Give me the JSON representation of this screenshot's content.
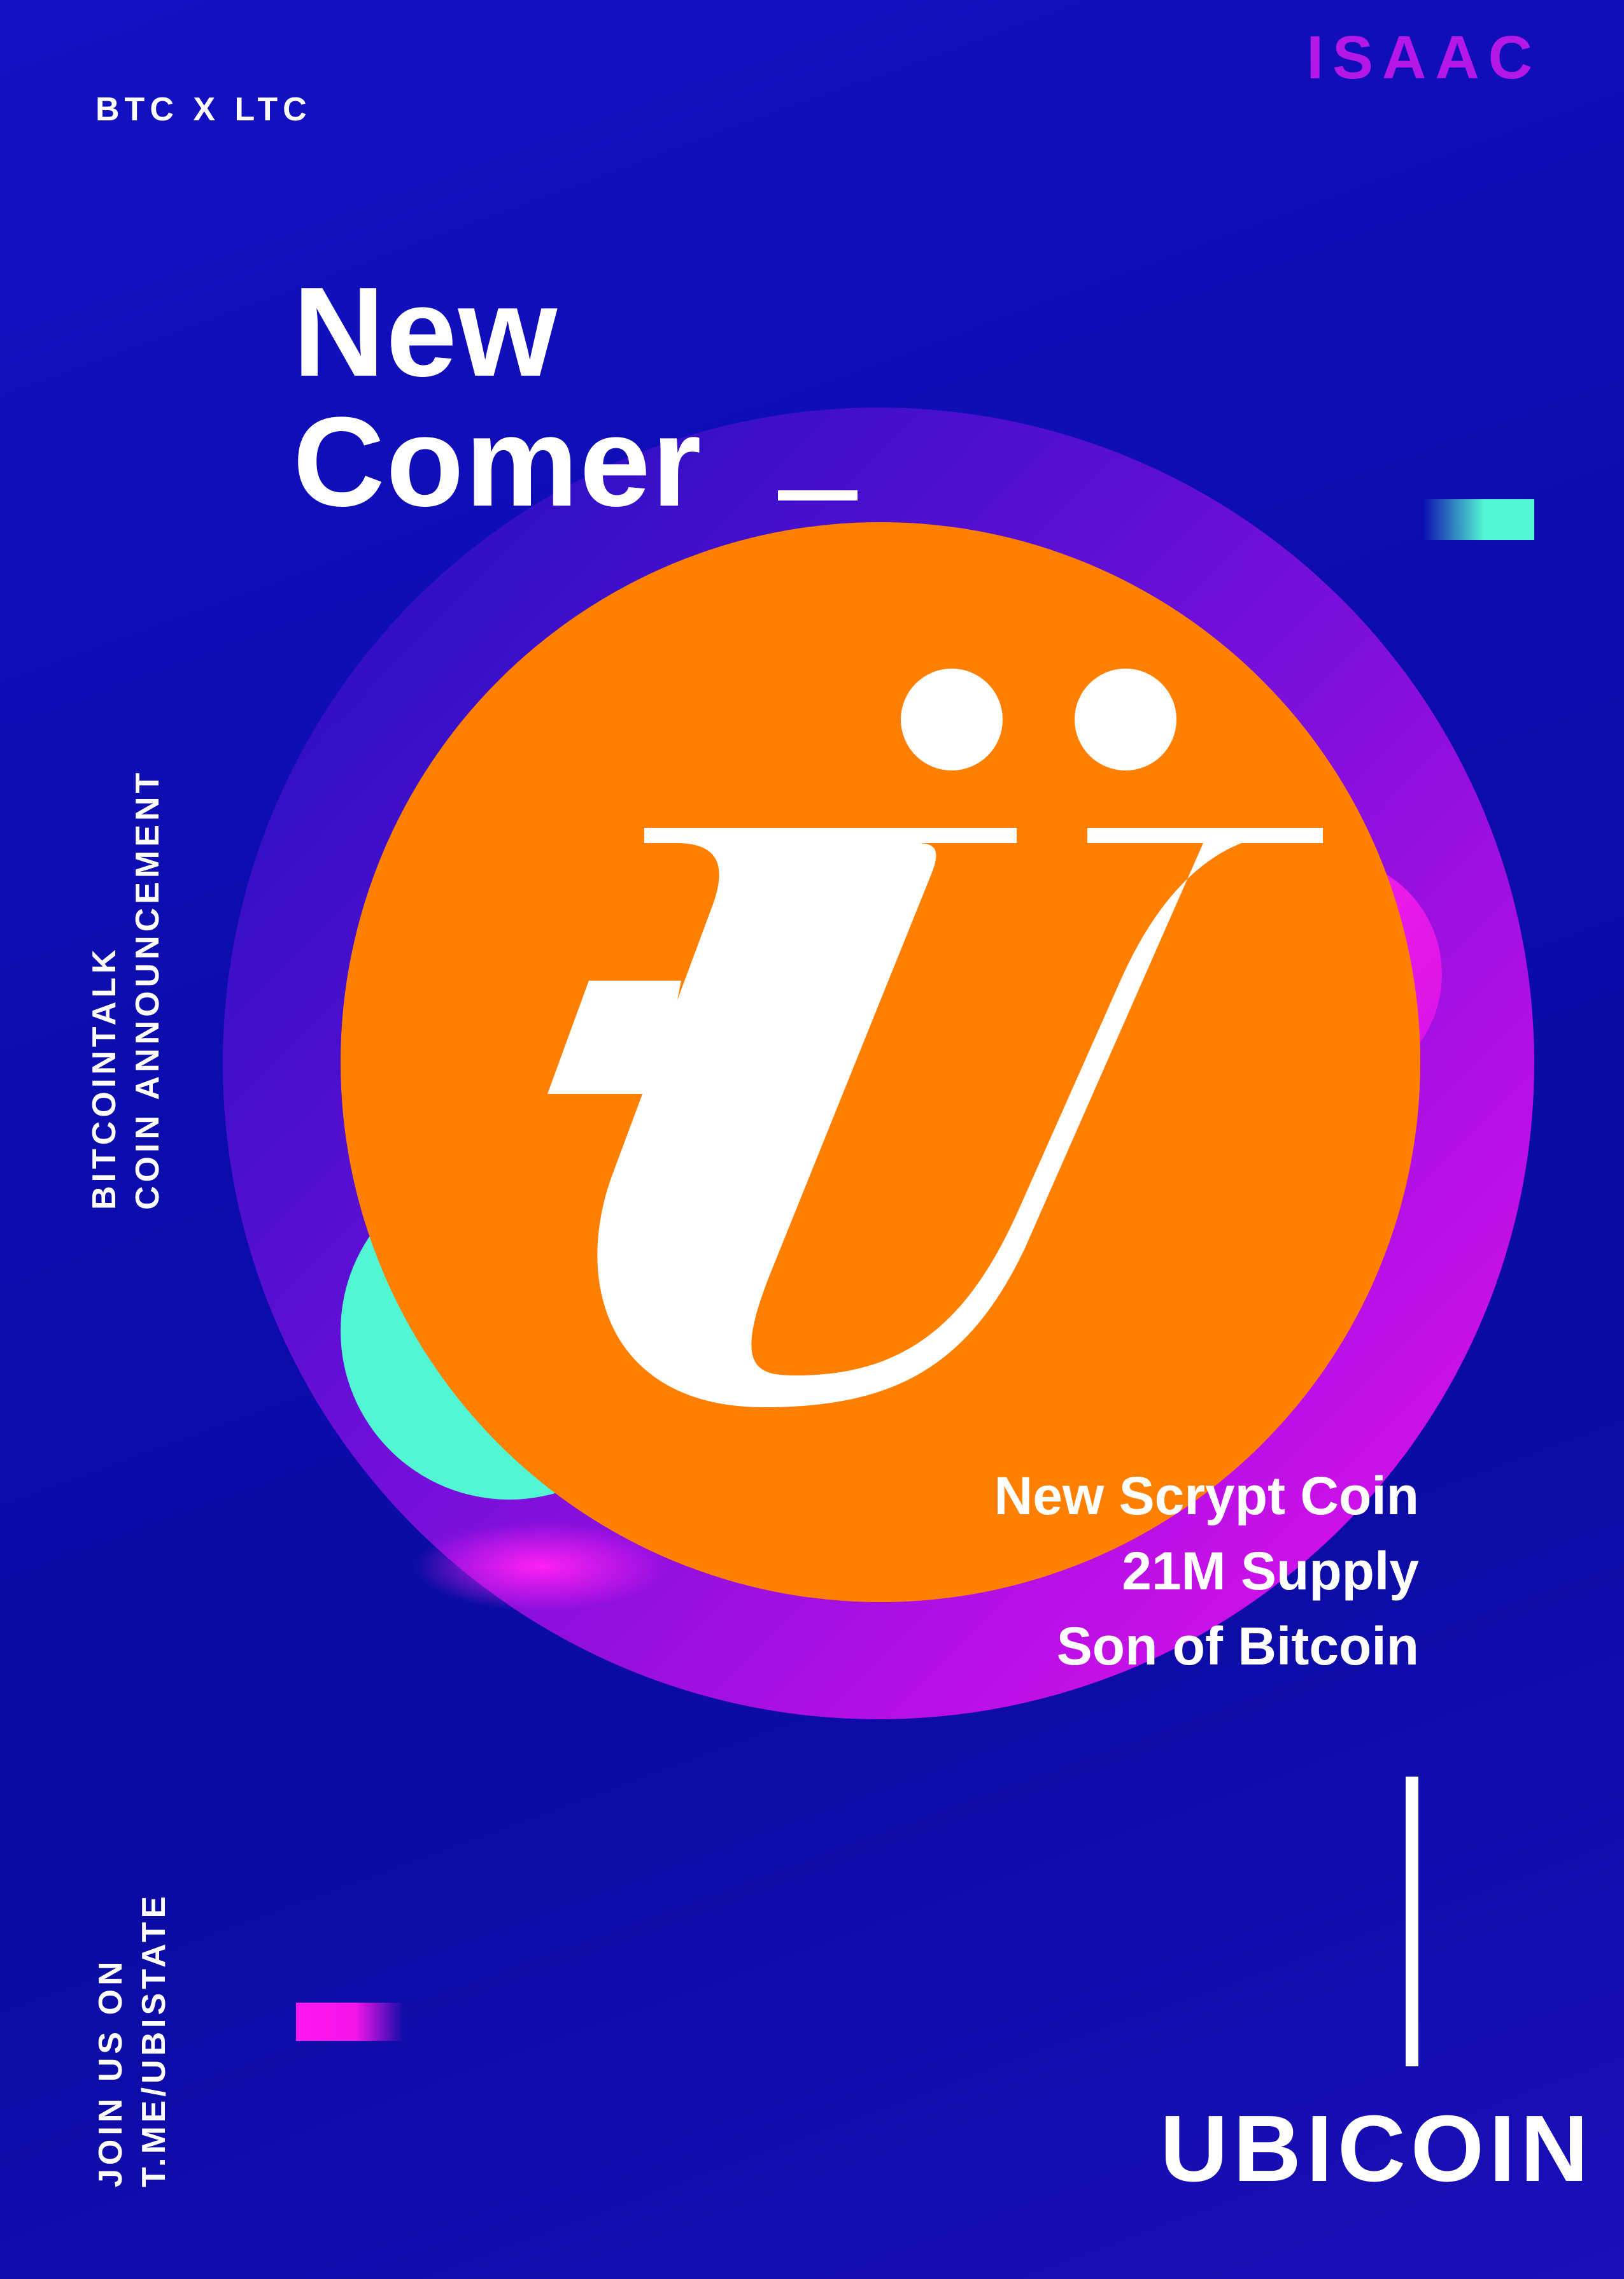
{
  "header": {
    "pair": "BTC X LTC",
    "author": "ISAAC"
  },
  "headline": {
    "line1": "New",
    "line2": "Comer"
  },
  "side": {
    "announcement_line1": "BITCOINTALK",
    "announcement_line2": "COIN ANNOUNCEMENT",
    "join_line1": "JOIN US ON",
    "join_line2": "T.ME/UBISTATE"
  },
  "features": [
    "New Scrypt Coin",
    "21M Supply",
    "Son of Bitcoin"
  ],
  "brand": "UBICOIN",
  "logo": {
    "icon": "ubicoin-u-umlaut-logo",
    "colors": {
      "disc": "#ff8000",
      "glyph": "#ffffff"
    }
  },
  "colors": {
    "background": "#0d0db0",
    "accent_purple": "#b417e6",
    "accent_magenta": "#f514ea",
    "accent_teal": "#52f6d2",
    "coin_orange": "#ff8000"
  }
}
